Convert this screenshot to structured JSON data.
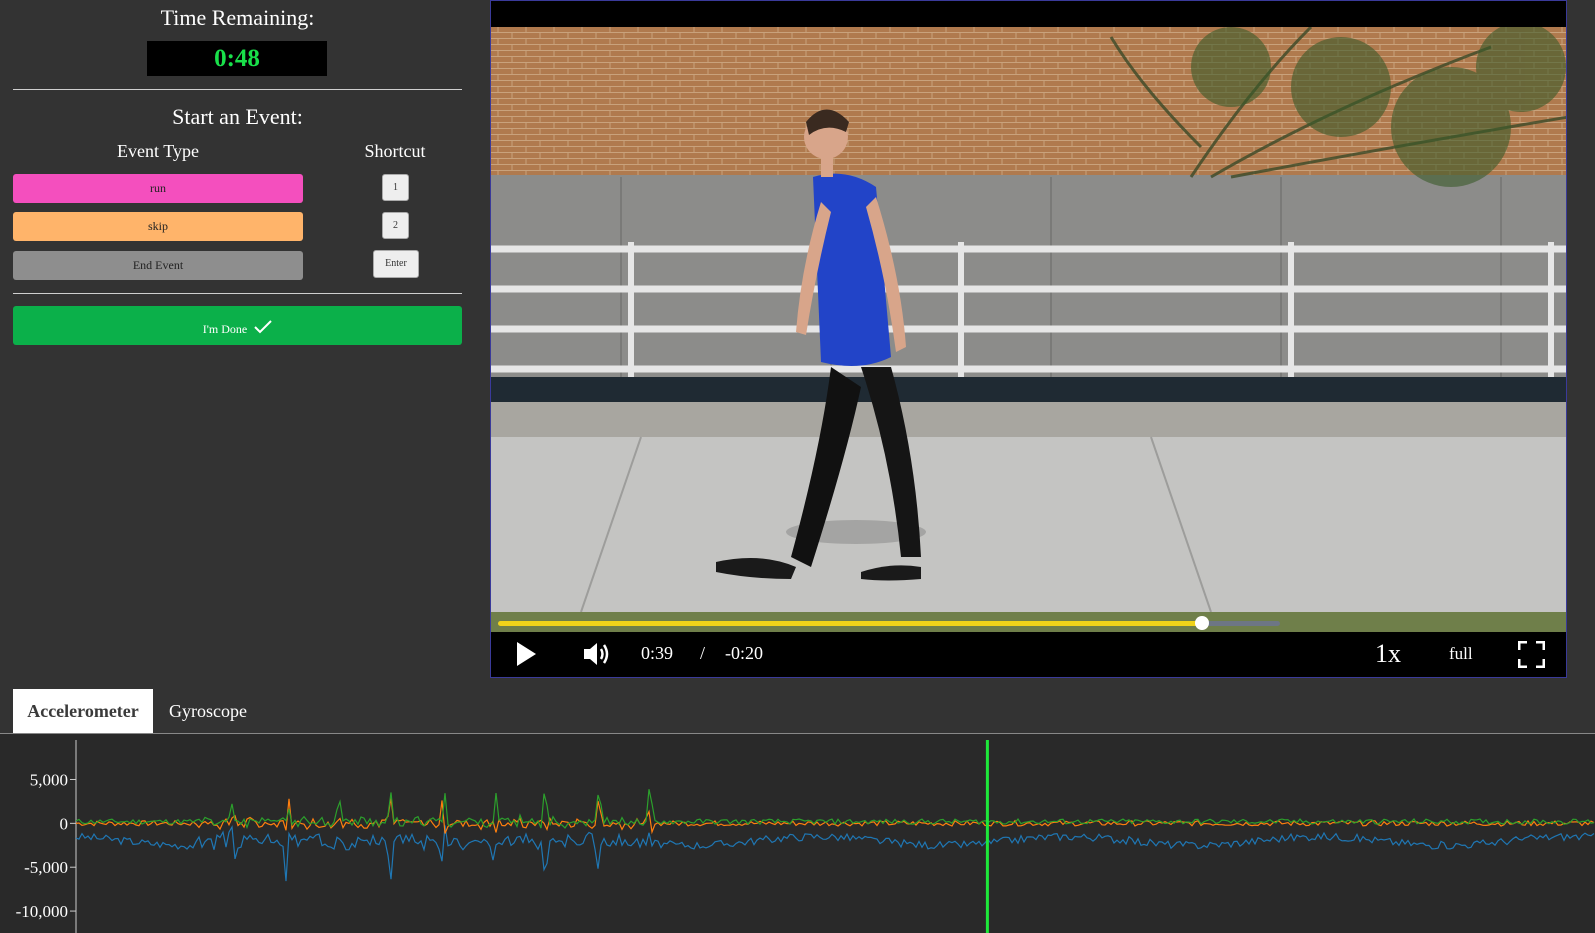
{
  "timer": {
    "label": "Time Remaining:",
    "value": "0:48"
  },
  "events": {
    "heading": "Start an Event:",
    "col_type": "Event Type",
    "col_shortcut": "Shortcut",
    "items": [
      {
        "label": "run",
        "shortcut": "1",
        "color": "#f44fbe"
      },
      {
        "label": "skip",
        "shortcut": "2",
        "color": "#ffb46a"
      },
      {
        "label": "End Event",
        "shortcut": "Enter",
        "color": "#8e8e8e"
      }
    ],
    "done_label": "I'm Done"
  },
  "video": {
    "current_time": "0:39",
    "separator": "/",
    "remaining_time": "-0:20",
    "speed": "1x",
    "mode": "full",
    "progress_fraction": 0.9,
    "colors": {
      "progress": "#f0d31a",
      "track": "#6d7685"
    }
  },
  "tabs": [
    {
      "label": "Accelerometer",
      "active": true
    },
    {
      "label": "Gyroscope",
      "active": false
    }
  ],
  "chart_data": {
    "type": "line",
    "y_ticks": [
      "5,000",
      "0",
      "-5,000",
      "-10,000"
    ],
    "y_tick_values": [
      5000,
      0,
      -5000,
      -10000
    ],
    "ylim": [
      -12500,
      9500
    ],
    "cursor_fraction": 0.6,
    "series_colors": [
      "#1f77b4",
      "#ff7f0e",
      "#2ca02c"
    ],
    "series": [
      {
        "mean": -2000,
        "noise": 450,
        "burst": 6000,
        "seed": 3
      },
      {
        "mean": 0,
        "noise": 300,
        "burst": 4000,
        "seed": 7
      },
      {
        "mean": 200,
        "noise": 300,
        "burst": 5000,
        "seed": 11
      }
    ]
  }
}
